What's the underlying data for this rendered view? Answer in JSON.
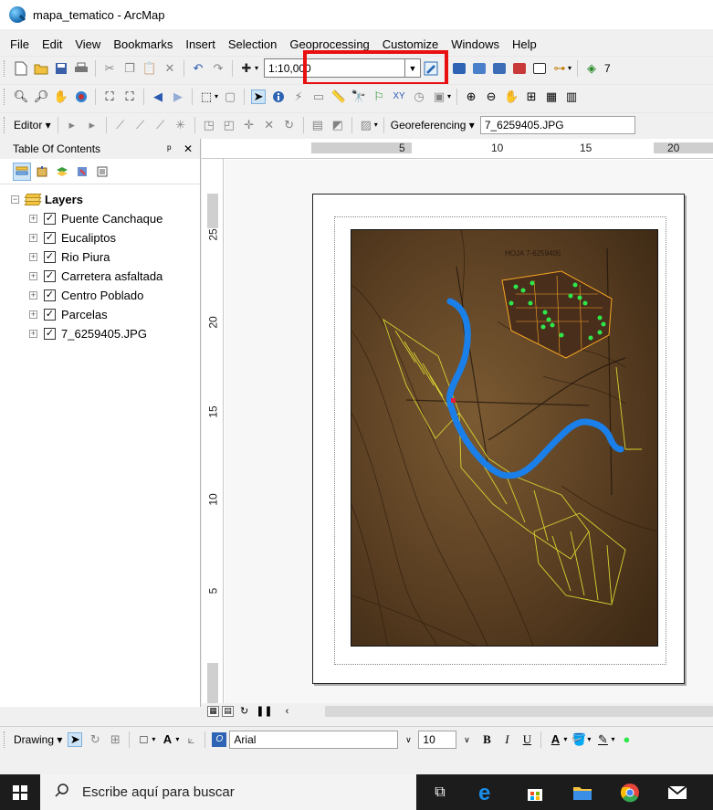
{
  "window": {
    "title": "mapa_tematico - ArcMap"
  },
  "menubar": [
    "File",
    "Edit",
    "View",
    "Bookmarks",
    "Insert",
    "Selection",
    "Geoprocessing",
    "Customize",
    "Windows",
    "Help"
  ],
  "standard_toolbar": {
    "scale_value": "1:10,000",
    "partial_label": "7"
  },
  "editor_toolbar": {
    "editor_label": "Editor ▾",
    "georef_label": "Georeferencing ▾",
    "georef_layer": "7_6259405.JPG"
  },
  "toc": {
    "title": "Table Of Contents",
    "pin": "ᵖ",
    "close": "✕",
    "root_label": "Layers",
    "layers": [
      {
        "name": "Puente Canchaque",
        "checked": true
      },
      {
        "name": "Eucaliptos",
        "checked": true
      },
      {
        "name": "Rio Piura",
        "checked": true
      },
      {
        "name": "Carretera asfaltada",
        "checked": true
      },
      {
        "name": "Centro Poblado",
        "checked": true
      },
      {
        "name": "Parcelas",
        "checked": true
      },
      {
        "name": "7_6259405.JPG",
        "checked": true
      }
    ]
  },
  "rulers": {
    "top": [
      "5",
      "10",
      "15",
      "20"
    ],
    "left": [
      "25",
      "20",
      "15",
      "10",
      "5"
    ]
  },
  "map_labels": {
    "sheet_label": "HOJA 7-6259405"
  },
  "drawing_toolbar": {
    "drawing_label": "Drawing ▾",
    "font": "Arial",
    "size": "10",
    "bold": "B",
    "italic": "I",
    "underline": "U",
    "font_color": "A"
  },
  "taskbar": {
    "search_placeholder": "Escribe aquí para buscar"
  },
  "colors": {
    "highlight": "#e81010",
    "river": "#1a7fe8",
    "parcel_outline": "#d7d431",
    "settlement_outline": "#f5a623",
    "eucalyptus": "#2ee84a"
  }
}
